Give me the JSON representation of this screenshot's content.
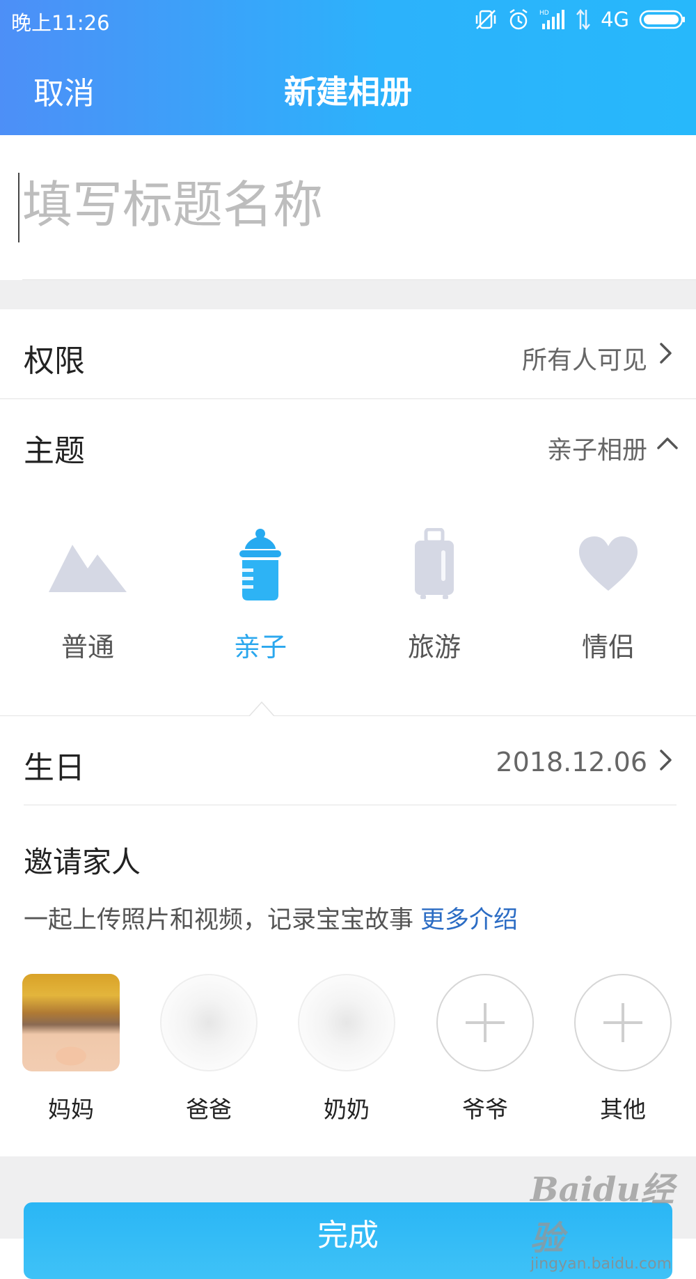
{
  "status_bar": {
    "time": "晚上11:26",
    "network": "4G",
    "icons": [
      "vibrate-off-icon",
      "alarm-icon",
      "hd-signal-icon",
      "data-arrows-icon",
      "battery-icon"
    ]
  },
  "nav": {
    "cancel_label": "取消",
    "title": "新建相册"
  },
  "title_field": {
    "placeholder": "填写标题名称",
    "value": ""
  },
  "permission": {
    "label": "权限",
    "value": "所有人可见"
  },
  "theme": {
    "label": "主题",
    "value": "亲子相册",
    "options": [
      {
        "label": "普通",
        "icon": "mountain-icon",
        "selected": false
      },
      {
        "label": "亲子",
        "icon": "baby-bottle-icon",
        "selected": true
      },
      {
        "label": "旅游",
        "icon": "suitcase-icon",
        "selected": false
      },
      {
        "label": "情侣",
        "icon": "heart-icon",
        "selected": false
      }
    ]
  },
  "birthday": {
    "label": "生日",
    "value": "2018.12.06"
  },
  "invite": {
    "title": "邀请家人",
    "description": "一起上传照片和视频，记录宝宝故事",
    "more_link": "更多介绍",
    "members": [
      {
        "label": "妈妈",
        "state": "joined"
      },
      {
        "label": "爸爸",
        "state": "blurred"
      },
      {
        "label": "奶奶",
        "state": "blurred"
      },
      {
        "label": "爷爷",
        "state": "add"
      },
      {
        "label": "其他",
        "state": "add"
      }
    ]
  },
  "done_button": {
    "label": "完成"
  },
  "watermark": {
    "logo": "Baidu经验",
    "url": "jingyan.baidu.com"
  },
  "colors": {
    "header_start": "#4d8ff7",
    "header_end": "#27b8fb",
    "accent": "#2aa7ee",
    "link": "#2b6cc4",
    "inactive_icon": "#d5d8e4"
  }
}
